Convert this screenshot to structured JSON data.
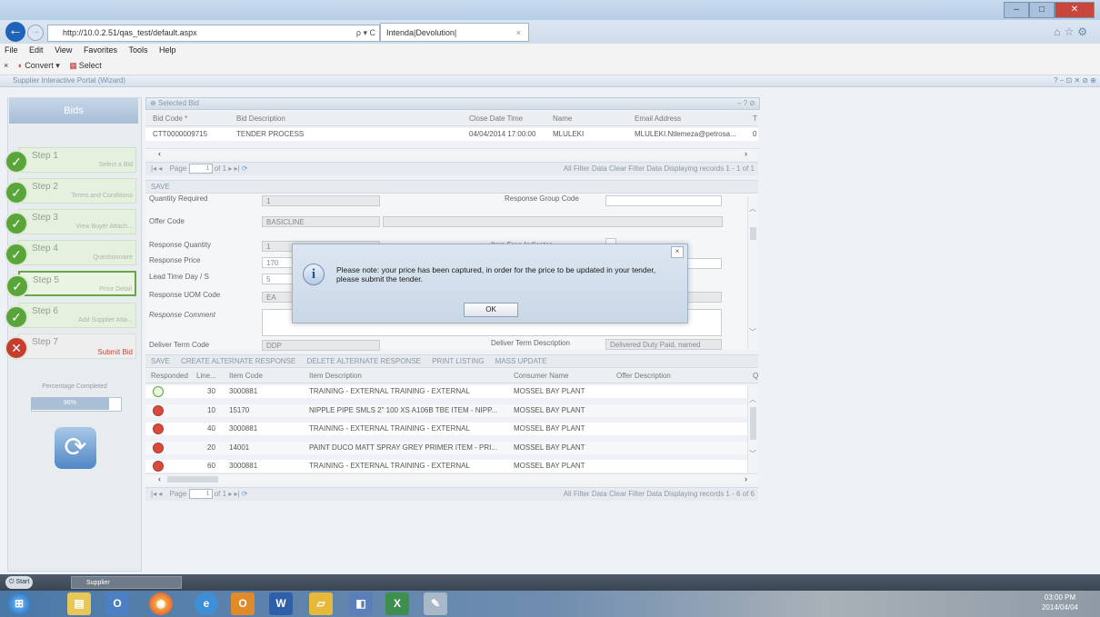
{
  "browser": {
    "url": "http://10.0.2.51/qas_test/default.aspx",
    "address_controls": "ρ ▾ C",
    "tab_title": "Intenda|Devolution|",
    "tab_close": "×",
    "menus": [
      "File",
      "Edit",
      "View",
      "Favorites",
      "Tools",
      "Help"
    ],
    "cmd_close": "×",
    "convert_label": "Convert",
    "select_label": "Select"
  },
  "portal": {
    "title": "Supplier Interactive Portal (Wizard)",
    "window_controls": "? – ⊡ ✕ ⊘ ⊕"
  },
  "wizard": {
    "bids_label": "Bids",
    "steps": [
      {
        "name": "Step 1",
        "desc": "Select a Bid",
        "status": "done"
      },
      {
        "name": "Step 2",
        "desc": "Terms and Conditions",
        "status": "done"
      },
      {
        "name": "Step 3",
        "desc": "View Buyer Attach...",
        "status": "done"
      },
      {
        "name": "Step 4",
        "desc": "Questionnaire",
        "status": "done"
      },
      {
        "name": "Step 5",
        "desc": "Price Detail",
        "status": "active"
      },
      {
        "name": "Step 6",
        "desc": "Add Supplier Atta...",
        "status": "done"
      },
      {
        "name": "Step 7",
        "desc": "Submit Bid",
        "status": "error"
      }
    ],
    "percentage_label": "Percentage Completed",
    "percentage_value": "86%",
    "percentage": 86
  },
  "selected_bid": {
    "header": "Selected Bid",
    "header_icons": "– ? ⊘",
    "columns": [
      "Bid Code *",
      "Bid Description",
      "Close Date Time",
      "Name",
      "Email Address",
      "T"
    ],
    "row": [
      "CTT0000009715",
      "TENDER PROCESS",
      "04/04/2014 17:00:00",
      "MLULEKI",
      "MLULEKI.Ntlemeza@petrosa...",
      "0"
    ],
    "pager": {
      "page_label": "Page",
      "page_value": "1",
      "of_label": "of 1",
      "right": "All Filter Data   Clear Filter Data   Displaying records 1 - 1 of 1"
    }
  },
  "response_form": {
    "save_label": "SAVE",
    "quantity_required_label": "Quantity Required",
    "quantity_required_value": "1",
    "response_group_code_label": "Response Group Code",
    "offer_code_label": "Offer Code",
    "offer_code_value": "BASICLINE",
    "response_quantity_label": "Response Quantity",
    "response_quantity_value": "1",
    "item_free_indicator_label": "Item Free Indicator",
    "response_price_label": "Response Price",
    "response_price_value": "170",
    "lead_time_label": "Lead Time Day / S",
    "lead_time_value": "5",
    "response_uom_label": "Response UOM Code",
    "response_uom_value": "EA",
    "response_comment_label": "Response Comment",
    "deliver_term_code_label": "Deliver Term Code",
    "deliver_term_code_value": "DDP",
    "deliver_term_desc_label": "Deliver Term Description",
    "deliver_term_desc_value": "Delivered Duty Paid, named"
  },
  "items": {
    "toolbar": [
      "SAVE",
      "CREATE ALTERNATE RESPONSE",
      "DELETE ALTERNATE RESPONSE",
      "PRINT LISTING",
      "MASS UPDATE"
    ],
    "columns": [
      "Responded",
      "Line...",
      "Item Code",
      "Item Description",
      "Consumer Name",
      "Offer Description",
      "Q"
    ],
    "rows": [
      {
        "status": "ok",
        "line": "30",
        "code": "3000881",
        "desc": "TRAINING - EXTERNAL TRAINING - EXTERNAL",
        "consumer": "MOSSEL BAY PLANT"
      },
      {
        "status": "err",
        "line": "10",
        "code": "15170",
        "desc": "NIPPLE PIPE SMLS 2\" 100 XS A106B TBE ITEM - NIPP...",
        "consumer": "MOSSEL BAY PLANT"
      },
      {
        "status": "err",
        "line": "40",
        "code": "3000881",
        "desc": "TRAINING - EXTERNAL TRAINING - EXTERNAL",
        "consumer": "MOSSEL BAY PLANT"
      },
      {
        "status": "err",
        "line": "20",
        "code": "14001",
        "desc": "PAINT DUCO MATT SPRAY GREY PRIMER ITEM - PRI...",
        "consumer": "MOSSEL BAY PLANT"
      },
      {
        "status": "err",
        "line": "60",
        "code": "3000881",
        "desc": "TRAINING - EXTERNAL TRAINING - EXTERNAL",
        "consumer": "MOSSEL BAY PLANT"
      }
    ],
    "pager": {
      "page_label": "Page",
      "page_value": "1",
      "of_label": "of 1",
      "right": "All Filter Data   Clear Filter Data   Displaying records 1 - 6 of 6"
    }
  },
  "dialog": {
    "close": "×",
    "icon_glyph": "i",
    "message": "Please note: your price has been captured, in order for the price to be updated in your tender, please submit the tender.",
    "ok_label": "OK"
  },
  "taskbar": {
    "start_label": "Start",
    "supplier_label": "Supplier",
    "clock_time": "03:00 PM",
    "clock_date": "2014/04/04"
  },
  "colors": {
    "accent": "#1f63b8",
    "done": "#5aa53a",
    "error": "#c63d30"
  }
}
